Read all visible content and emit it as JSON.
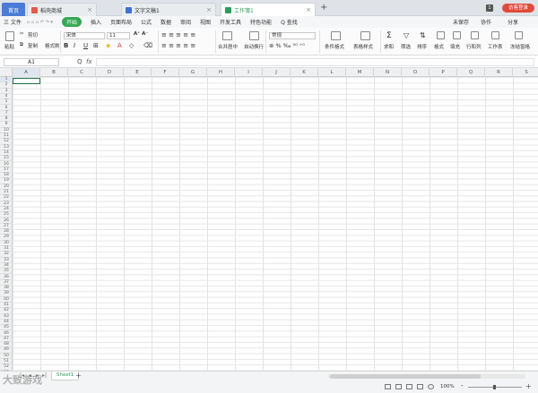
{
  "tabs": {
    "home": "首页",
    "t1": "稻壳商城",
    "t2": "文字文稿1",
    "t3": "工作簿1",
    "new_tab": "+",
    "count_badge": "1",
    "login": "访客登录"
  },
  "menu": {
    "file": "三 文件",
    "items": [
      "开始",
      "插入",
      "页面布局",
      "公式",
      "数据",
      "审阅",
      "视图",
      "开发工具",
      "特色功能"
    ],
    "search": "Q 查找",
    "unsaved": "未保存",
    "collab": "协作",
    "share": "分享"
  },
  "ribbon": {
    "paste": "粘贴",
    "cut": "剪切",
    "copy": "复制",
    "format_painter": "格式刷",
    "font_name": "宋体",
    "font_size": "11",
    "bold": "B",
    "italic": "I",
    "underline": "U",
    "merge_center": "合并居中",
    "wrap_text": "自动换行",
    "number_format": "常规",
    "cond_format": "条件格式",
    "table_style": "表格样式",
    "sum": "求和",
    "filter": "筛选",
    "sort": "排序",
    "format": "格式",
    "fill": "填充",
    "row_col": "行和列",
    "worksheet": "工作表",
    "freeze": "冻结窗格"
  },
  "formula_bar": {
    "cell_ref": "A1",
    "zoom_icon": "Q",
    "fx": "fx",
    "content": ""
  },
  "grid": {
    "columns": [
      "A",
      "B",
      "C",
      "D",
      "E",
      "F",
      "G",
      "H",
      "I",
      "J",
      "K",
      "L",
      "M",
      "N",
      "O",
      "P",
      "Q",
      "R",
      "S"
    ],
    "rows": [
      "1",
      "2",
      "3",
      "4",
      "5",
      "6",
      "7",
      "8",
      "9",
      "10",
      "11",
      "12",
      "13",
      "14",
      "15",
      "16",
      "17",
      "18",
      "19",
      "20",
      "21",
      "22",
      "23",
      "24",
      "25",
      "26",
      "27",
      "28",
      "29",
      "30",
      "31",
      "32",
      "33",
      "34",
      "35",
      "36",
      "37",
      "38",
      "39",
      "40",
      "41",
      "42",
      "43",
      "44",
      "45",
      "46",
      "47",
      "48",
      "49",
      "50",
      "51",
      "52",
      "53"
    ]
  },
  "sheetbar": {
    "sheet_name": "Sheet1",
    "add": "+"
  },
  "statusbar": {
    "zoom": "100%",
    "minus": "-",
    "plus": "+"
  },
  "watermark": "大致游戏",
  "colors": {
    "accent_green": "#34a853",
    "home_tab": "#4a7bd6",
    "login_red": "#e04a3a",
    "active_cell": "#217346"
  }
}
